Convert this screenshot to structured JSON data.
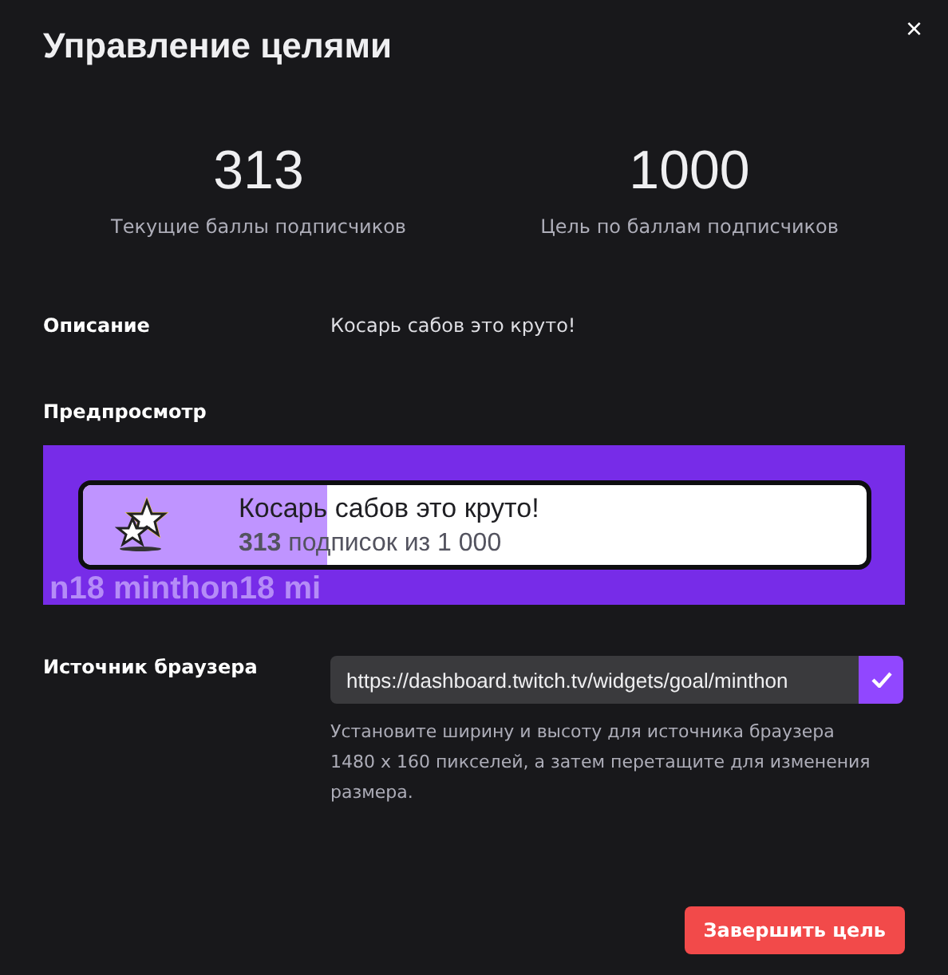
{
  "dialog": {
    "title": "Управление целями",
    "close": "×"
  },
  "stats": [
    {
      "value": "313",
      "label": "Текущие баллы подписчиков"
    },
    {
      "value": "1000",
      "label": "Цель по баллам подписчиков"
    }
  ],
  "description": {
    "label": "Описание",
    "value": "Косарь сабов это круто!"
  },
  "preview": {
    "label": "Предпросмотр",
    "background_text": "n18 minthon18 mi",
    "goal_title": "Косарь сабов это круто!",
    "current": "313",
    "progress_text": "подписок из 1 000",
    "level": 0.313
  },
  "browser_source": {
    "label": "Источник браузера",
    "value": "https://dashboard.twitch.tv/widgets/goal/minthon",
    "hint": "Установите ширину и высоту для источника браузера 1480 x 160 пикселей, а затем перетащите для изменения размера."
  },
  "end_button": "Завершить цель"
}
